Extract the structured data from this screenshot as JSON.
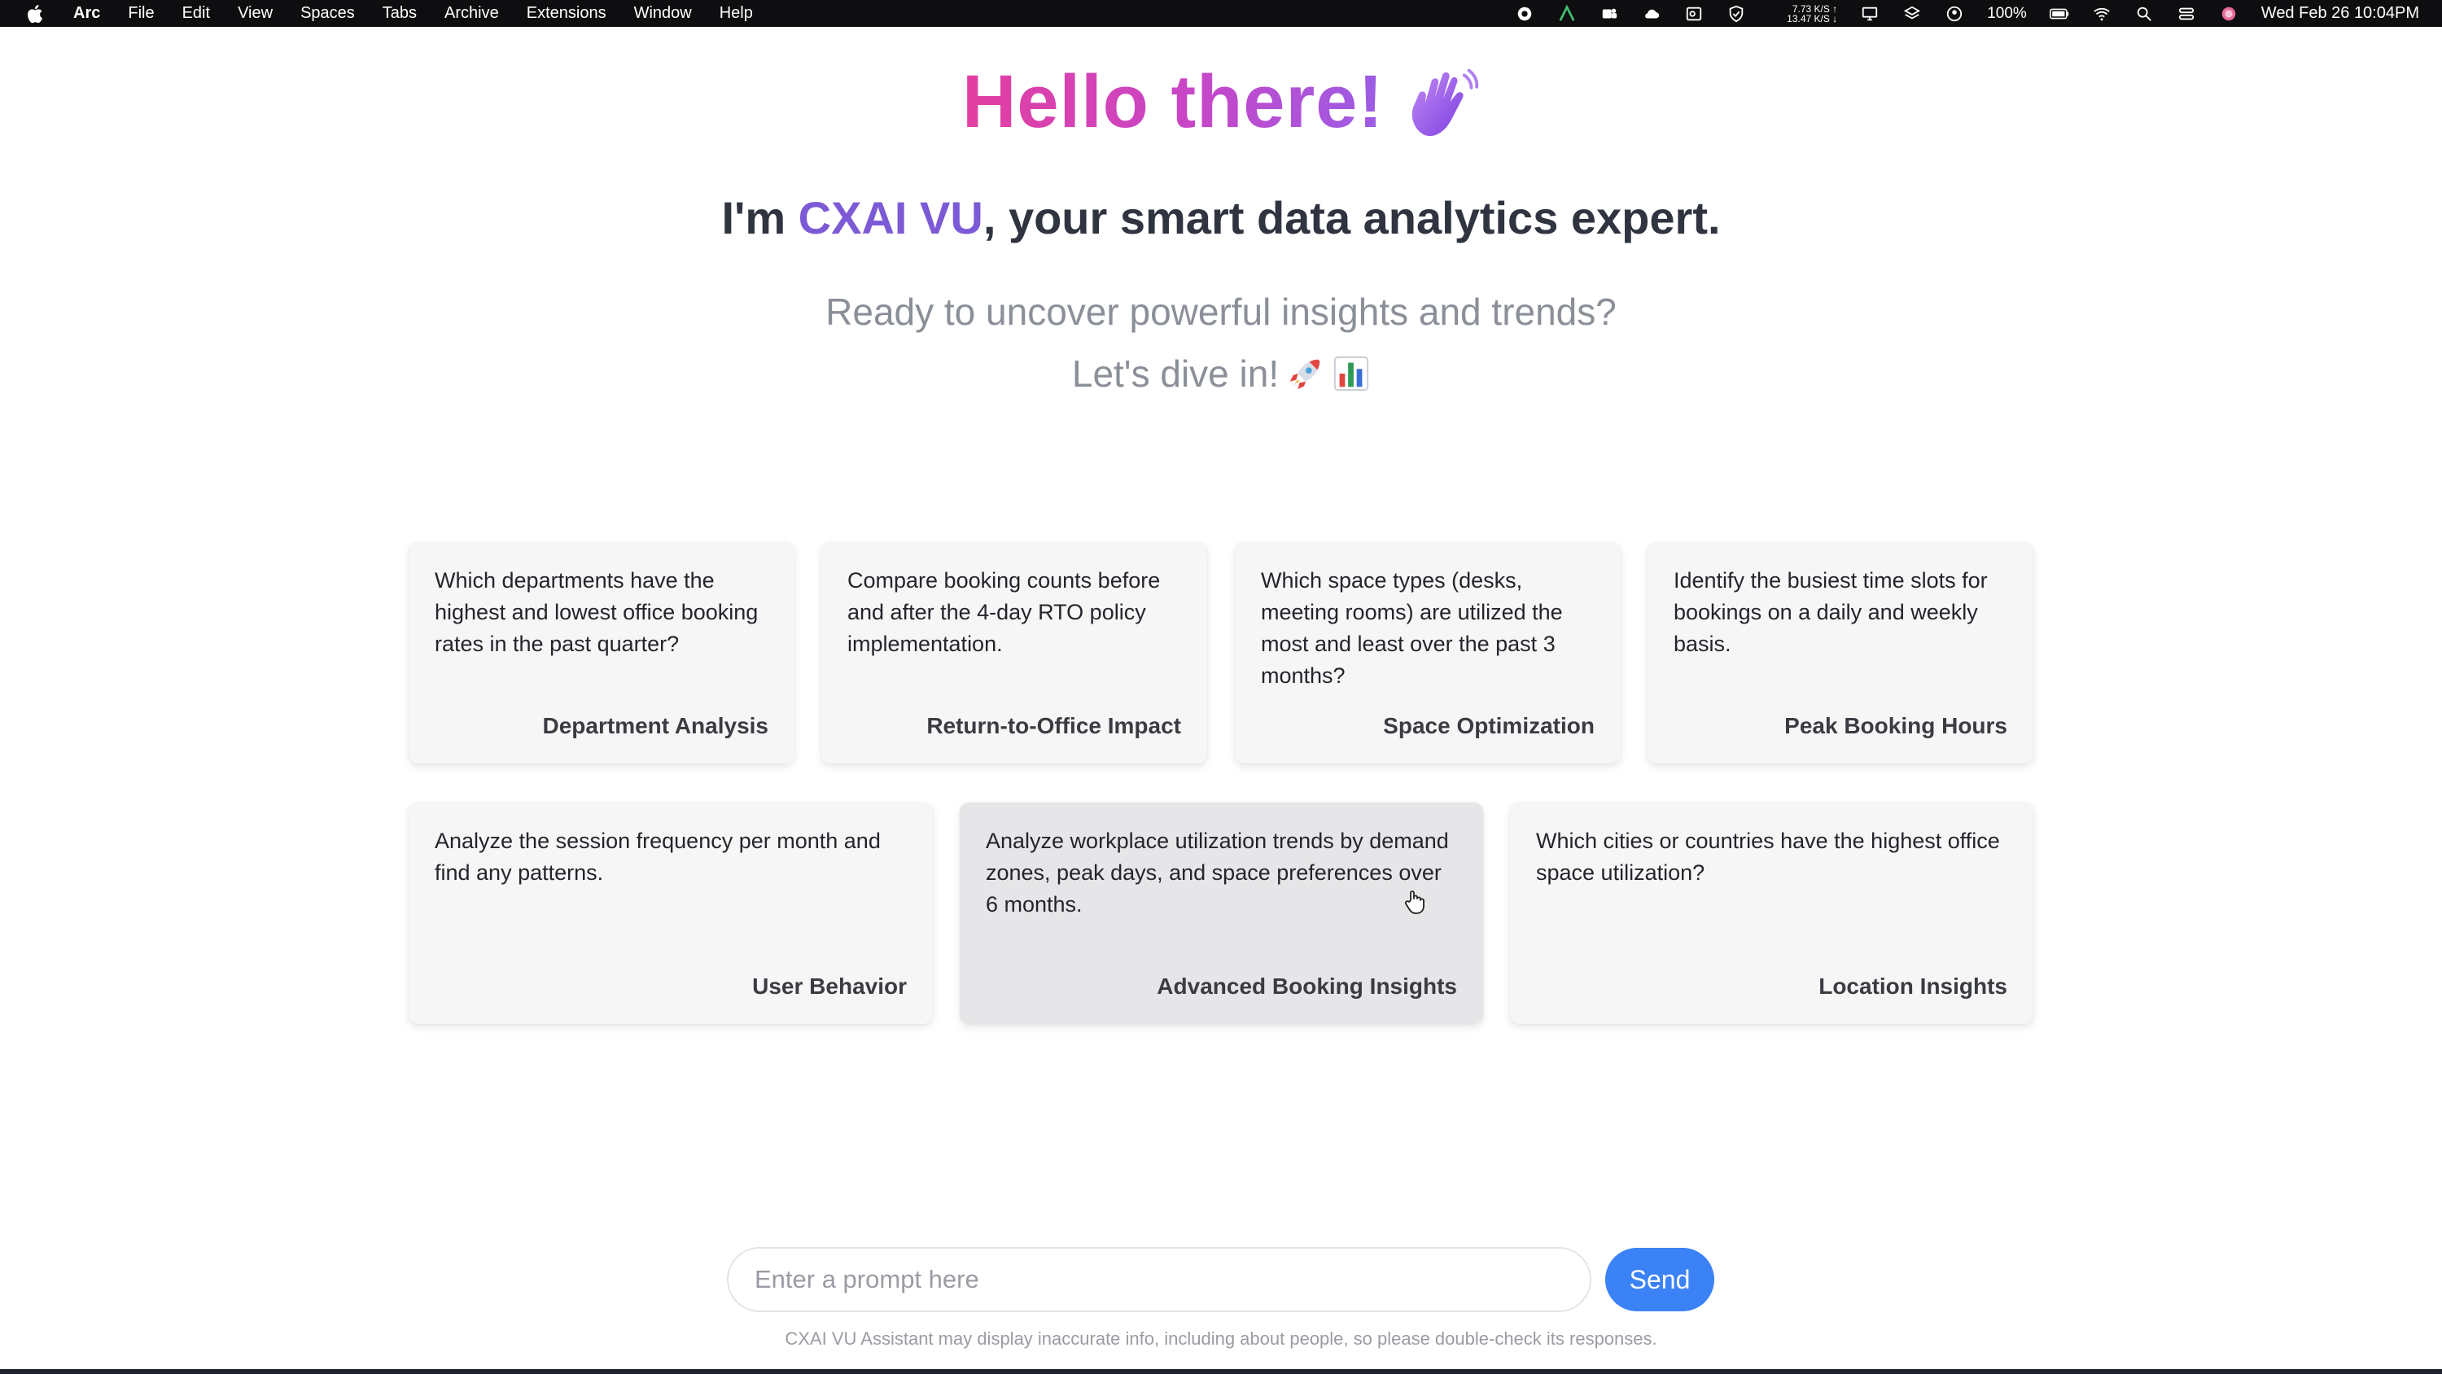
{
  "menubar": {
    "app_name": "Arc",
    "items": [
      "File",
      "Edit",
      "View",
      "Spaces",
      "Tabs",
      "Archive",
      "Extensions",
      "Window",
      "Help"
    ],
    "net_up": "7.73 K/S ↑",
    "net_down": "13.47 K/S ↓",
    "battery": "100%",
    "datetime": "Wed Feb 26  10:04PM"
  },
  "hero": {
    "title": "Hello there!",
    "sub_prefix": "I'm ",
    "brand": "CXAI VU",
    "sub_suffix": ", your smart data analytics expert.",
    "tagline1": "Ready to uncover powerful insights and trends?",
    "tagline2": "Let's dive in!"
  },
  "cards": [
    {
      "question": "Which departments have the highest and lowest office booking rates in the past quarter?",
      "title": "Department Analysis"
    },
    {
      "question": "Compare booking counts before and after the 4-day RTO policy implementation.",
      "title": "Return-to-Office Impact"
    },
    {
      "question": "Which space types (desks, meeting rooms) are utilized the most and least over the past 3 months?",
      "title": "Space Optimization"
    },
    {
      "question": "Identify the busiest time slots for bookings on a daily and weekly basis.",
      "title": "Peak Booking Hours"
    },
    {
      "question": "Analyze the session frequency per month and find any patterns.",
      "title": "User Behavior"
    },
    {
      "question": "Analyze workplace utilization trends by demand zones, peak days, and space preferences over 6 months.",
      "title": "Advanced Booking Insights"
    },
    {
      "question": "Which cities or countries have the highest office space utilization?",
      "title": "Location Insights"
    }
  ],
  "prompt": {
    "placeholder": "Enter a prompt here",
    "value": "",
    "send_label": "Send",
    "disclaimer": "CXAI VU Assistant may display inaccurate info, including about people, so please double-check its responses."
  },
  "colors": {
    "brand": "#7c5ad6",
    "send": "#3b82f6",
    "title_gradient_start": "#e33fa0",
    "title_gradient_end": "#9b5de5"
  }
}
